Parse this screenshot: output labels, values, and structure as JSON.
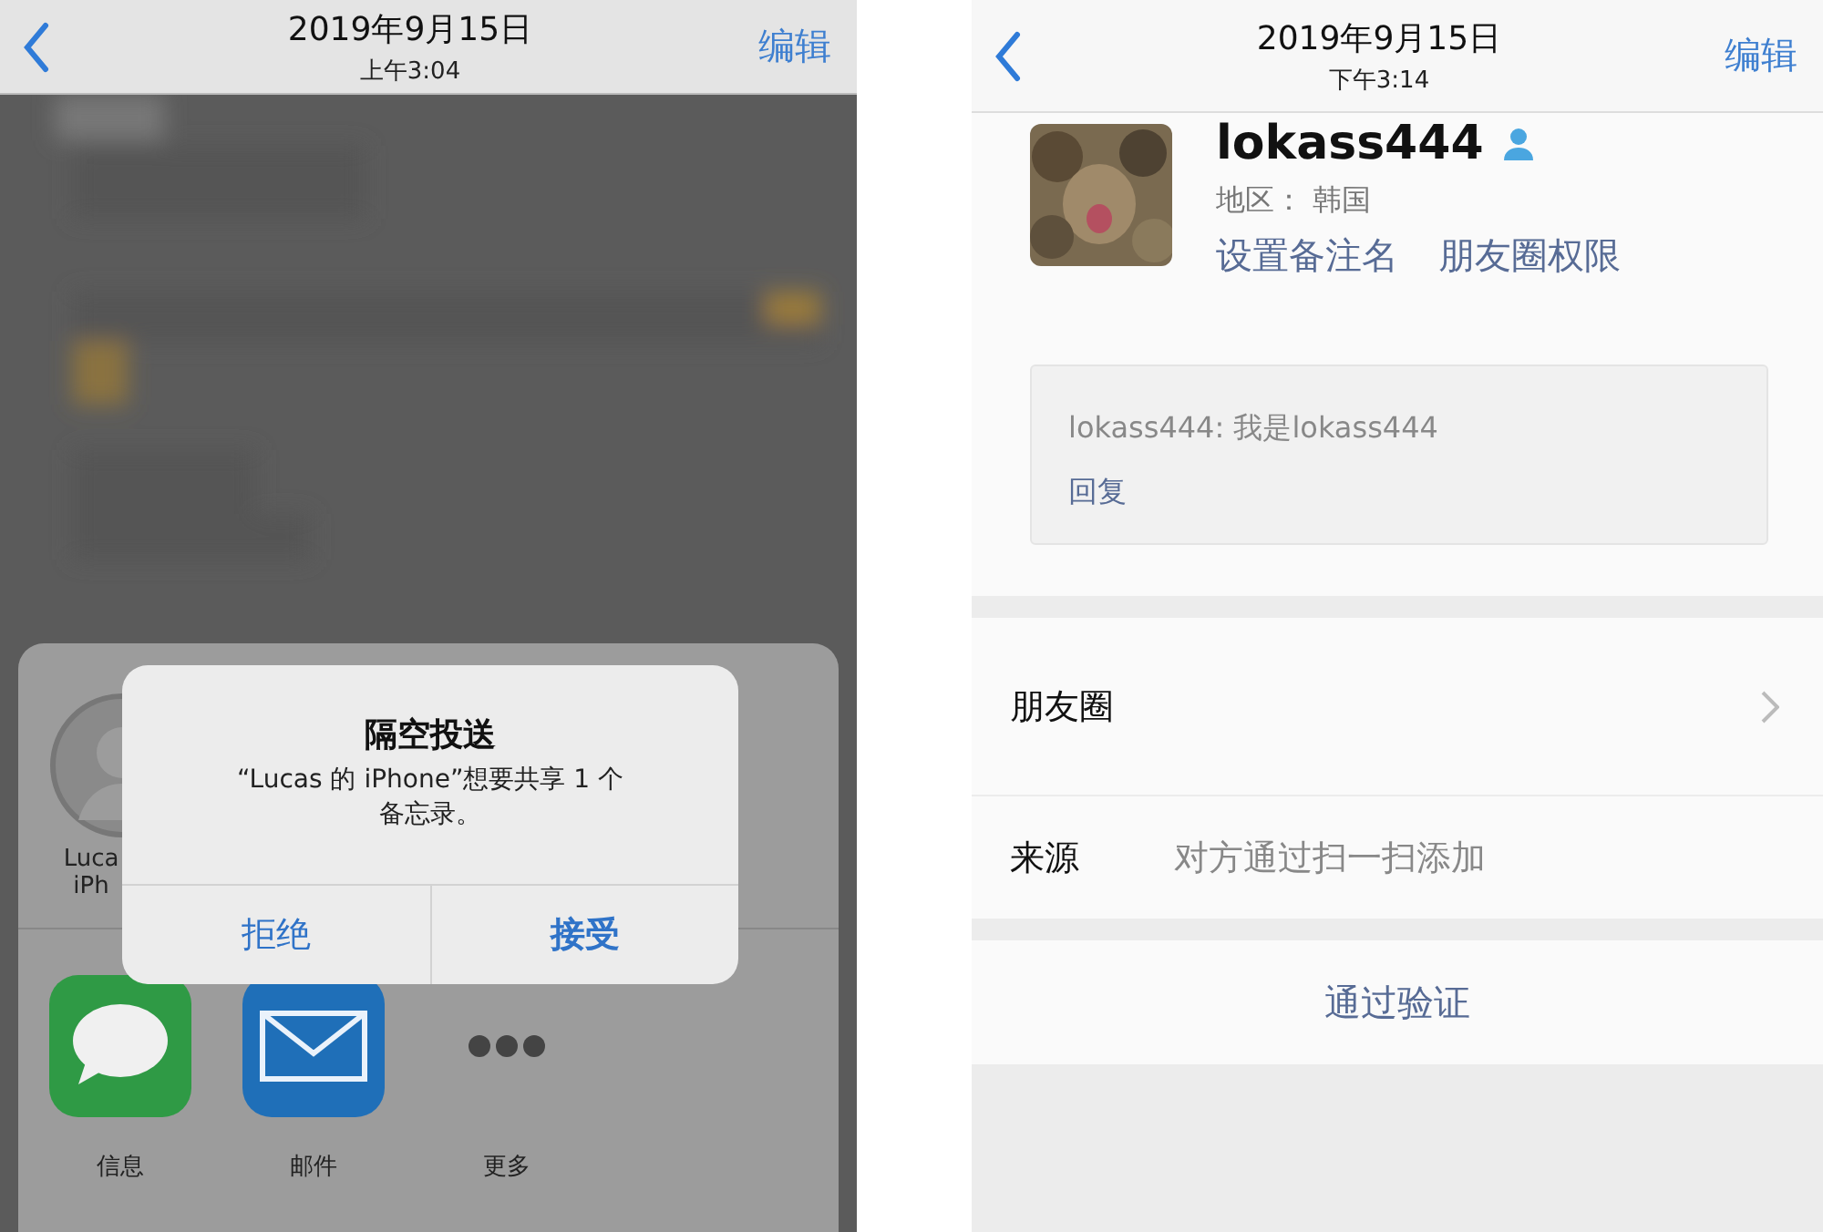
{
  "left_screen": {
    "header": {
      "date": "2019年9月15日",
      "time": "上午3:04",
      "edit": "编辑"
    },
    "background": {
      "kind": "picture"
    },
    "share_sheet": {
      "contact": {
        "name_lines": [
          "Luca",
          "iPh"
        ]
      },
      "apps": [
        {
          "kind": "messages",
          "label": "信息"
        },
        {
          "kind": "mail",
          "label": "邮件"
        },
        {
          "kind": "more",
          "label": "更多"
        }
      ]
    },
    "alert": {
      "title": "隔空投送",
      "message": "“Lucas 的 iPhone”想要共享 1 个备忘录。",
      "buttons": [
        "拒绝",
        "接受"
      ]
    }
  },
  "right_screen": {
    "header": {
      "date": "2019年9月15日",
      "time": "下午3:14",
      "edit": "编辑"
    },
    "profile": {
      "avatar": {
        "kind": "picture"
      },
      "name": "lokass444",
      "region": "地区：  韩国",
      "links": [
        "设置备注名",
        "朋友圈权限"
      ]
    },
    "message": {
      "text": "lokass444: 我是lokass444",
      "reply": "回复"
    },
    "rows": [
      {
        "kind": "link",
        "label": "朋友圈"
      },
      {
        "kind": "info",
        "label": "来源",
        "value": "对方通过扫一扫添加"
      }
    ],
    "action": "通过验证"
  }
}
